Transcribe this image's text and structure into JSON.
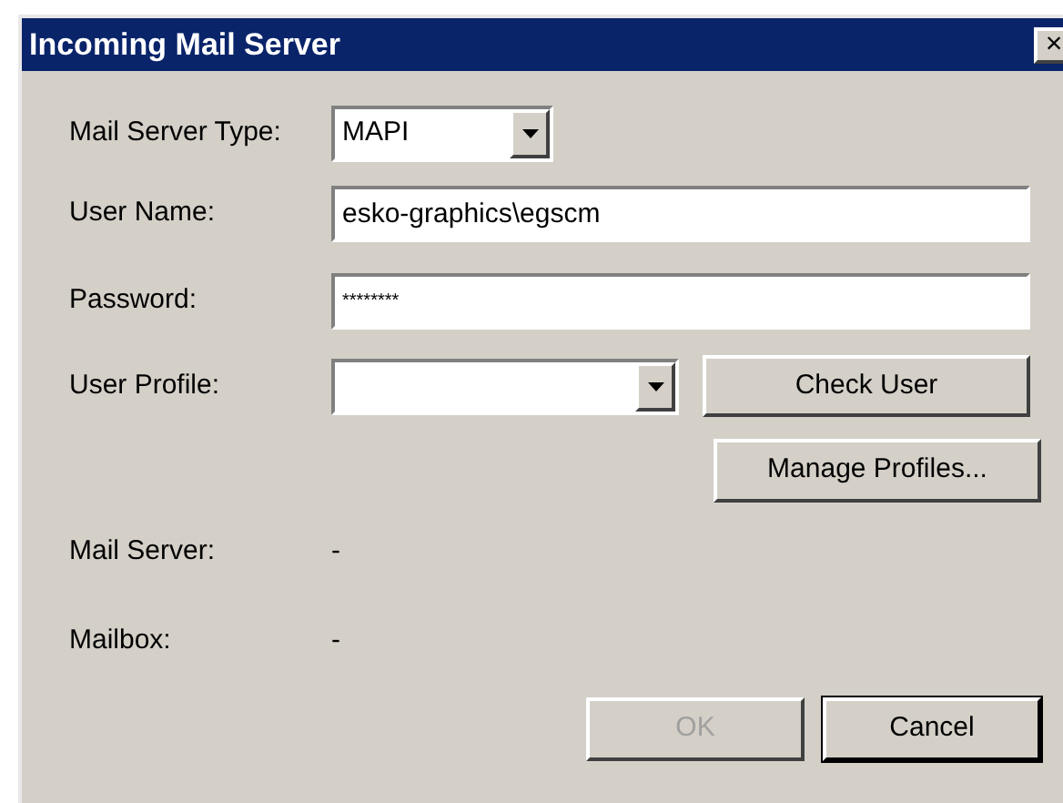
{
  "window": {
    "title": "Incoming Mail Server",
    "close": "×"
  },
  "mail_server_type": {
    "label": "Mail Server Type:",
    "value": "MAPI"
  },
  "user_name": {
    "label": "User Name:",
    "value": "esko-graphics\\egscm"
  },
  "password": {
    "label": "Password:",
    "value": "********"
  },
  "user_profile": {
    "label": "User Profile:"
  },
  "check_user": {
    "label": "Check User",
    "disabled": false
  },
  "manage_profiles": {
    "label": "Manage Profiles...",
    "disabled": false
  },
  "info": [
    {
      "label": "Mail Server:",
      "value": "-"
    },
    {
      "label": "Mailbox:",
      "value": "-"
    }
  ],
  "buttons": [
    {
      "label": "OK",
      "disabled": true,
      "default": false
    },
    {
      "label": "Cancel",
      "disabled": false,
      "default": true
    }
  ]
}
